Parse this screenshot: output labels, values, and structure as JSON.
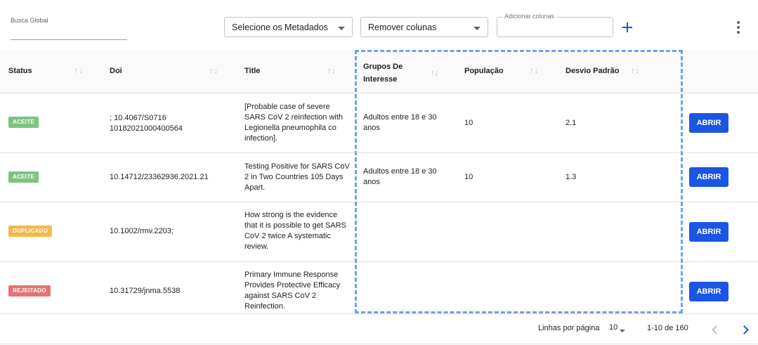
{
  "toolbar": {
    "global_search_label": "Busca Global",
    "global_search_value": "",
    "metadata_select_value": "Selecione os Metadados",
    "remove_columns_value": "Remover colunas",
    "add_columns_label": "Adicionar colunas",
    "add_columns_value": "",
    "add_icon": "plus-icon",
    "menu_icon": "more-vertical-icon"
  },
  "table": {
    "columns": [
      "Status",
      "Doi",
      "Title",
      "Grupos De Interesse",
      "População",
      "Desvio Padrão"
    ],
    "sort_arrows": "↑↓",
    "rows": [
      {
        "status": "ACEITE",
        "status_color": "#7cc47f",
        "doi": "; 10.4067/S0716 10182021000400564",
        "title": "[Probable case of severe SARS CoV 2 reinfection with Legionella pneumophila co infection].",
        "grupos": "Adultos entre 18 e 30 anos",
        "populacao": "10",
        "desvio": "2.1",
        "action": "ABRIR"
      },
      {
        "status": "ACEITE",
        "status_color": "#7cc47f",
        "doi": "10.14712/23362936.2021.21",
        "title": "Testing Positive for SARS CoV 2 in Two Countries 105 Days Apart.",
        "grupos": "Adultos entre 18 e 30 anos",
        "populacao": "10",
        "desvio": "1.3",
        "action": "ABRIR"
      },
      {
        "status": "DUPLICADO",
        "status_color": "#f4b84b",
        "doi": "10.1002/rmv.2203;",
        "title": "How strong is the evidence that it is possible to get SARS CoV 2 twice A systematic review.",
        "grupos": "",
        "populacao": "",
        "desvio": "",
        "action": "ABRIR"
      },
      {
        "status": "REJEITADO",
        "status_color": "#e57373",
        "doi": "10.31729/jnma.5538",
        "title": "Primary Immune Response Provides Protective Efficacy against SARS CoV 2 Reinfection.",
        "grupos": "",
        "populacao": "",
        "desvio": "",
        "action": "ABRIR"
      }
    ]
  },
  "pagination": {
    "rows_per_page_label": "Linhas por página",
    "rows_per_page_value": "10",
    "range_text": "1-10 de 160",
    "prev_icon": "chevron-left-icon",
    "next_icon": "chevron-right-icon"
  },
  "colors": {
    "accent": "#1a55e3",
    "highlight": "#6f9ff2"
  }
}
